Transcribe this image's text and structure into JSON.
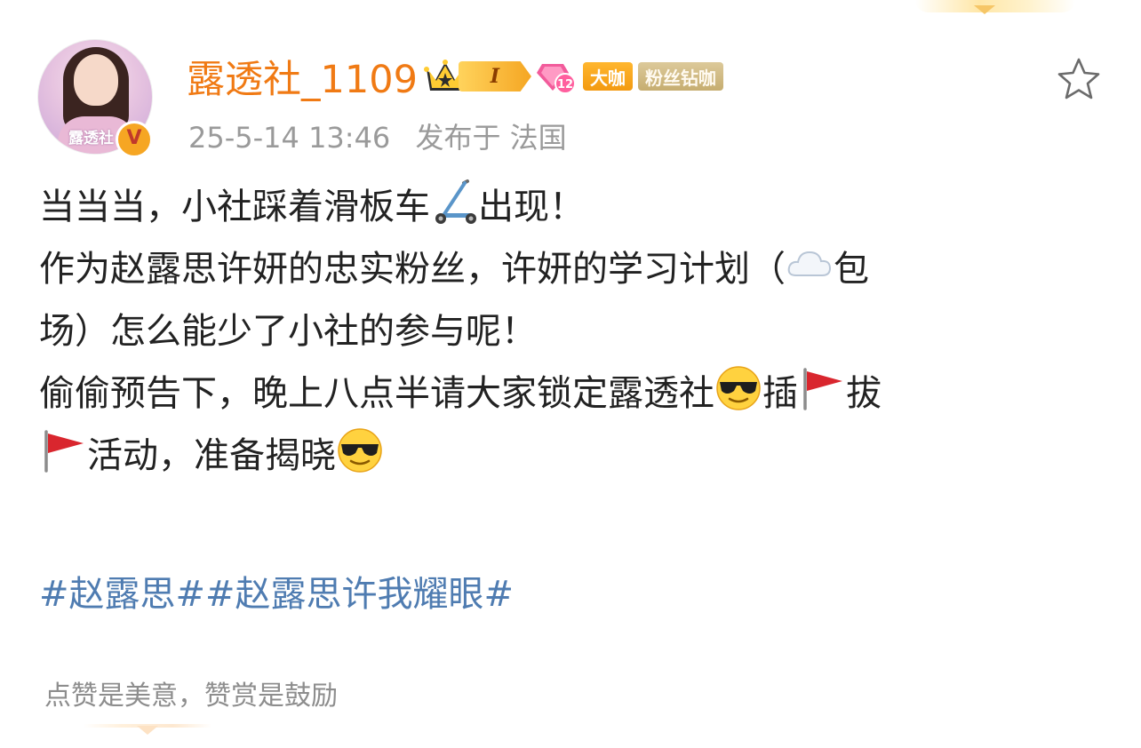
{
  "post": {
    "author": {
      "name": "露透社_1109",
      "level_badge": "I",
      "svip_level": "12",
      "badges": [
        "大咖",
        "粉丝钻咖"
      ],
      "avatar_caption": "露透社",
      "verified_mark": "V"
    },
    "time": "25-5-14 13:46",
    "location": "发布于 法国",
    "lines": {
      "l1_a": "当当当，小社踩着滑板车",
      "l1_b": "出现！",
      "l2_a": "作为赵露思许妍的忠实粉丝，许妍的学习计划（",
      "l2_b": "包",
      "l3": "场）怎么能少了小社的参与呢！",
      "l4_a": "偷偷预告下，晚上八点半请大家锁定露透社",
      "l4_b": "插",
      "l4_c": "拔",
      "l5_a": "活动，准备揭晓"
    },
    "emojis": [
      "scooter-emoji",
      "cloud-emoji",
      "sunglasses-emoji",
      "red-flag-emoji"
    ],
    "hashtags": [
      "#赵露思#",
      "#赵露思许我耀眼#"
    ],
    "footer_note": "点赞是美意，赞赏是鼓励"
  },
  "colors": {
    "username": "#f07a14",
    "hashtag": "#4f7cb1",
    "meta": "#9a9a9a",
    "big_badge": "#f39a11",
    "fan_badge": "#c6ad70"
  }
}
